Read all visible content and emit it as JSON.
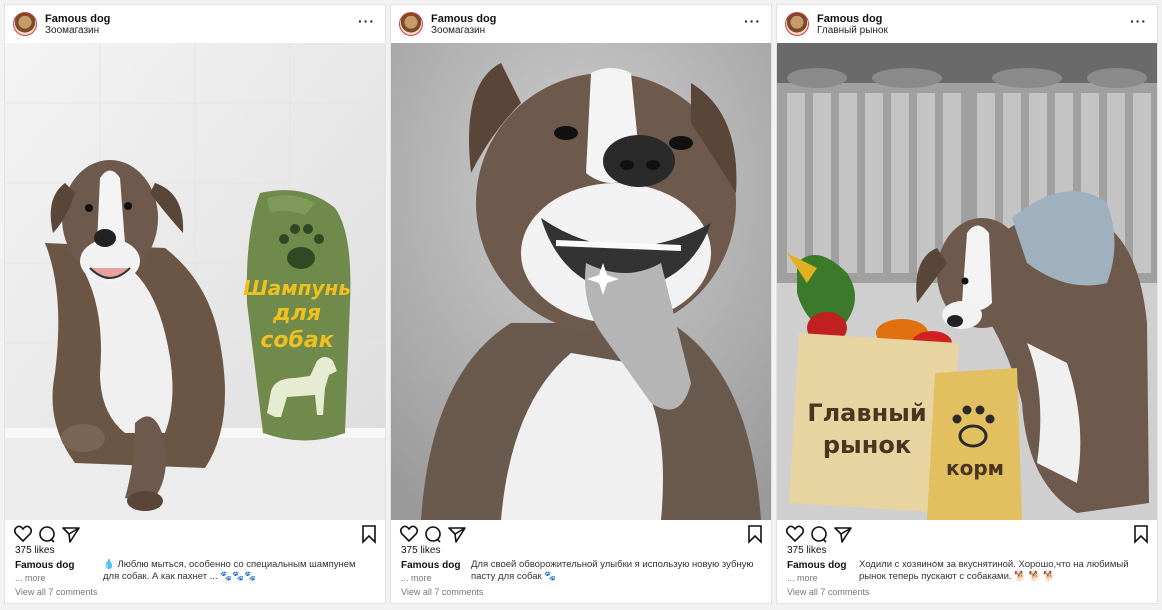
{
  "posts": [
    {
      "account": "Famous dog",
      "location": "Зоомагазин",
      "likes": "375 likes",
      "username": "Famous dog",
      "more": "... more",
      "caption": "Люблю мыться, особенно со специальным шампунем для собак. А как пахнет ...",
      "caption_prefix_icon": "droplet-emoji",
      "caption_suffix_icons": "paw-prints-emoji",
      "comments": "View all 7 comments",
      "overlay": {
        "line1": "Шампунь",
        "line2": "для",
        "line3": "собак"
      }
    },
    {
      "account": "Famous dog",
      "location": "Зоомагазин",
      "likes": "375 likes",
      "username": "Famous dog",
      "more": "... more",
      "caption": "Для своей обворожительной улыбки я использую новую зубную пасту для собак",
      "caption_suffix_icons": "paw-prints-emoji",
      "comments": "View all 7 comments"
    },
    {
      "account": "Famous dog",
      "location": "Главный рынок",
      "likes": "375 likes",
      "username": "Famous dog",
      "more": "... more",
      "caption": "Ходили с хозяином за вкуснятиной. Хорошо,что на любимый рынок теперь пускают с собаками.",
      "caption_suffix_icons": "dog-emoji",
      "comments": "View all 7 comments",
      "overlay": {
        "bag_line1": "Главный",
        "bag_line2": "рынок",
        "bag2_text": "корм"
      }
    }
  ],
  "colors": {
    "shampoo_bottle": "#6f8a4a",
    "shampoo_text": "#f0c020",
    "bag": "#e8d4a0",
    "bag_small": "#e2c060"
  }
}
